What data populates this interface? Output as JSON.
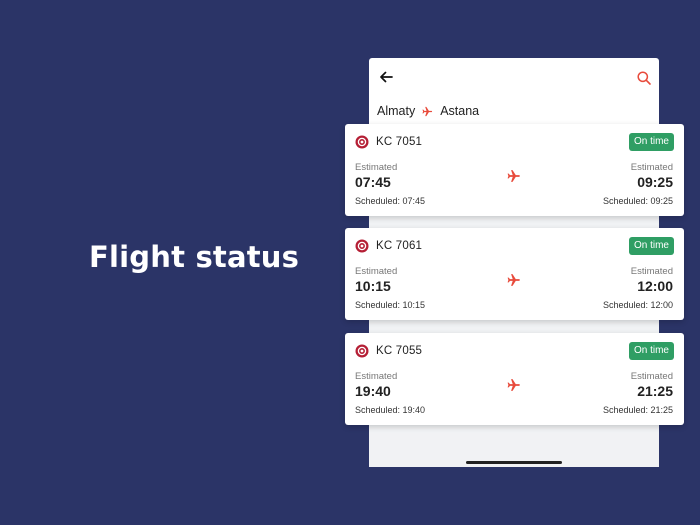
{
  "headline": "Flight status",
  "route": {
    "from": "Almaty",
    "to": "Astana"
  },
  "colors": {
    "background": "#2b3467",
    "accent": "#e84b3c",
    "badge": "#2f9e64",
    "logo": "#b51f35"
  },
  "flights": [
    {
      "number": "KC 7051",
      "status": "On time",
      "dep_label": "Estimated",
      "dep_time": "07:45",
      "dep_sched": "Scheduled: 07:45",
      "arr_label": "Estimated",
      "arr_time": "09:25",
      "arr_sched": "Scheduled: 09:25"
    },
    {
      "number": "KC 7061",
      "status": "On time",
      "dep_label": "Estimated",
      "dep_time": "10:15",
      "dep_sched": "Scheduled: 10:15",
      "arr_label": "Estimated",
      "arr_time": "12:00",
      "arr_sched": "Scheduled: 12:00"
    },
    {
      "number": "KC 7055",
      "status": "On time",
      "dep_label": "Estimated",
      "dep_time": "19:40",
      "dep_sched": "Scheduled: 19:40",
      "arr_label": "Estimated",
      "arr_time": "21:25",
      "arr_sched": "Scheduled: 21:25"
    }
  ],
  "icons": {
    "back": "arrow-left-icon",
    "search": "search-icon",
    "plane": "plane-icon",
    "airline": "airline-logo-icon"
  }
}
